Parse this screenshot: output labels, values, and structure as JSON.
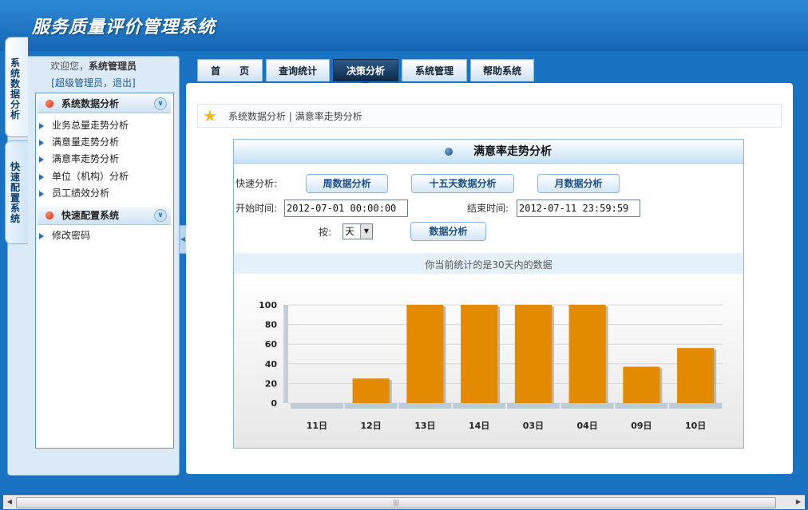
{
  "app": {
    "title": "服务质量评价管理系统"
  },
  "sidebar": {
    "welcome_prefix": "欢迎您，",
    "user_name": "系统管理员",
    "role_link": "[超级管理员",
    "logout_link": "退出]",
    "vertical_tabs": [
      {
        "label": "系统数据分析"
      },
      {
        "label": "快速配置系统"
      }
    ],
    "sections": [
      {
        "label": "系统数据分析",
        "items": [
          "业务总量走势分析",
          "满意量走势分析",
          "满意率走势分析",
          "单位（机构）分析",
          "员工绩效分析"
        ]
      },
      {
        "label": "快速配置系统",
        "items": [
          "修改密码"
        ]
      }
    ]
  },
  "tabs": [
    {
      "label": "首　　页",
      "active": false
    },
    {
      "label": "查询统计",
      "active": false
    },
    {
      "label": "决策分析",
      "active": true
    },
    {
      "label": "系统管理",
      "active": false
    },
    {
      "label": "帮助系统",
      "active": false
    }
  ],
  "breadcrumb": {
    "text": "系统数据分析 | 满意率走势分析"
  },
  "panel": {
    "title": "满意率走势分析",
    "quick_label": "快速分析:",
    "week_button": "周数据分析",
    "fifteen_button": "十五天数据分析",
    "month_button": "月数据分析",
    "start_label": "开始时间:",
    "start_value": "2012-07-01 00:00:00",
    "end_label": "结束时间:",
    "end_value": "2012-07-11 23:59:59",
    "by_label": "按:",
    "unit_value": "天",
    "analyze_button": "数据分析",
    "info_text": "你当前统计的是30天内的数据"
  },
  "chart_data": {
    "type": "bar",
    "categories": [
      "11日",
      "12日",
      "13日",
      "14日",
      "03日",
      "04日",
      "09日",
      "10日"
    ],
    "values": [
      0,
      25,
      100,
      100,
      100,
      100,
      37,
      56
    ],
    "ylim": [
      0,
      100
    ],
    "yticks": [
      0,
      20,
      40,
      60,
      80,
      100
    ],
    "bar_color": "#e38a00",
    "grid": true
  },
  "colors": {
    "brand": "#1a73c2",
    "accent": "#0b2a4a",
    "bar": "#e38a00"
  }
}
